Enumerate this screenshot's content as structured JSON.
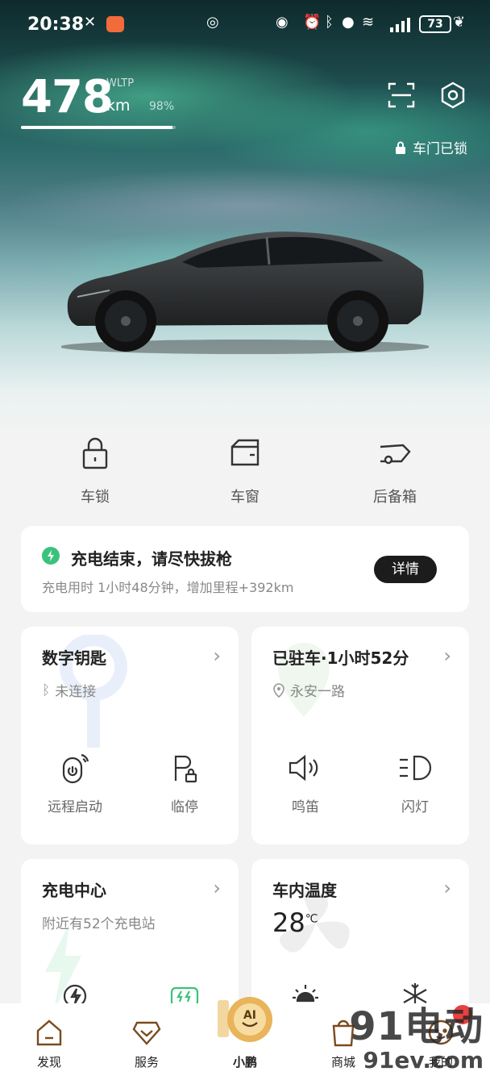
{
  "status_bar": {
    "time": "20:38",
    "battery": "73"
  },
  "hero": {
    "range": "478",
    "range_unit": "km",
    "range_standard": "WLTP",
    "battery_percent": "98%",
    "battery_fill": 0.98,
    "lock_status": "车门已锁"
  },
  "quick_actions": [
    {
      "label": "车锁",
      "icon": "lock-icon"
    },
    {
      "label": "车窗",
      "icon": "window-icon"
    },
    {
      "label": "后备箱",
      "icon": "trunk-icon"
    }
  ],
  "charge_card": {
    "title": "充电结束，请尽快拔枪",
    "subtitle": "充电用时 1小时48分钟，增加里程+392km",
    "button": "详情"
  },
  "tiles": {
    "digital_key": {
      "title": "数字钥匙",
      "status": "未连接",
      "actions": [
        {
          "label": "远程启动"
        },
        {
          "label": "临停"
        }
      ]
    },
    "parked": {
      "title": "已驻车·1小时52分",
      "location": "永安一路",
      "actions": [
        {
          "label": "鸣笛"
        },
        {
          "label": "闪灯"
        }
      ]
    },
    "charging_center": {
      "title": "充电中心",
      "subtitle": "附近有52个充电站"
    },
    "cabin_temp": {
      "title": "车内温度",
      "value": "28",
      "unit": "℃"
    }
  },
  "bottom_nav": [
    {
      "label": "发现"
    },
    {
      "label": "服务"
    },
    {
      "label": "小鹏"
    },
    {
      "label": "商城"
    },
    {
      "label": "我的"
    }
  ],
  "ai_badge": "AI",
  "watermark": {
    "big": "91电动",
    "small": "91ev.com"
  },
  "colors": {
    "accent_green": "#39c27b",
    "button_dark": "#1c1c1c"
  }
}
